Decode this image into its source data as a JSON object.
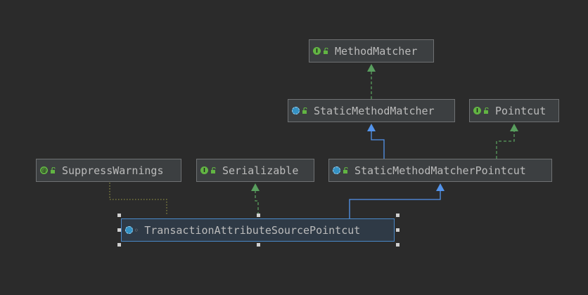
{
  "diagram": {
    "nodes": [
      {
        "id": "method-matcher",
        "label": "MethodMatcher",
        "kind": "interface",
        "badge": "I"
      },
      {
        "id": "static-method-matcher",
        "label": "StaticMethodMatcher",
        "kind": "abstract-class",
        "badge": ""
      },
      {
        "id": "pointcut",
        "label": "Pointcut",
        "kind": "interface",
        "badge": "I"
      },
      {
        "id": "suppress-warnings",
        "label": "SuppressWarnings",
        "kind": "annotation",
        "badge": "@"
      },
      {
        "id": "serializable",
        "label": "Serializable",
        "kind": "interface",
        "badge": "I"
      },
      {
        "id": "static-method-matcher-pointcut",
        "label": "StaticMethodMatcherPointcut",
        "kind": "abstract-class",
        "badge": ""
      },
      {
        "id": "transaction-attribute-source-pointcut",
        "label": "TransactionAttributeSourcePointcut",
        "kind": "abstract-class",
        "badge": "",
        "selected": true
      }
    ],
    "edges": [
      {
        "from": "static-method-matcher",
        "to": "method-matcher",
        "relation": "implements"
      },
      {
        "from": "static-method-matcher-pointcut",
        "to": "static-method-matcher",
        "relation": "extends"
      },
      {
        "from": "static-method-matcher-pointcut",
        "to": "pointcut",
        "relation": "implements"
      },
      {
        "from": "transaction-attribute-source-pointcut",
        "to": "static-method-matcher-pointcut",
        "relation": "extends"
      },
      {
        "from": "transaction-attribute-source-pointcut",
        "to": "serializable",
        "relation": "implements"
      },
      {
        "from": "transaction-attribute-source-pointcut",
        "to": "suppress-warnings",
        "relation": "annotated-with"
      }
    ]
  },
  "colors": {
    "background": "#2b2b2b",
    "node_fill": "#3c3f41",
    "extends_edge": "#5394ec",
    "implements_edge": "#599e5e",
    "annotation_edge": "#8a8a42",
    "selection": "#4a88c7"
  }
}
